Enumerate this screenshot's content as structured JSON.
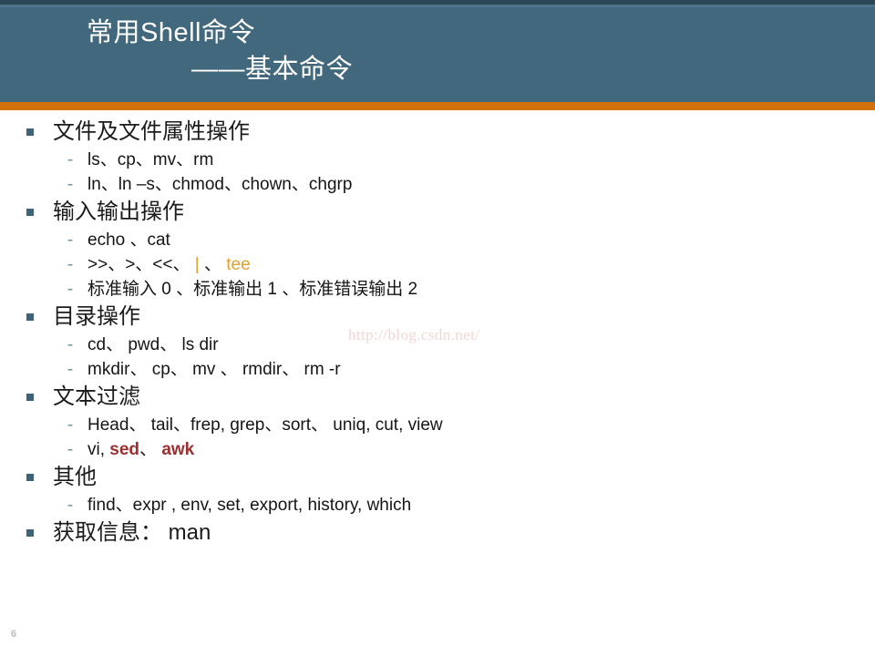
{
  "slide": {
    "title_line_1": "常用Shell命令",
    "title_line_2": "——基本命令",
    "number": "6",
    "watermark": "http://blog.csdn.net/",
    "colors": {
      "header_bg": "#42687d",
      "accent_bar": "#d2700c",
      "bullet": "#3f6376",
      "highlight_gold": "#e2a033",
      "highlight_red": "#9c3030"
    }
  },
  "sections": [
    {
      "heading": "文件及文件属性操作",
      "items": [
        {
          "text": "ls、cp、mv、rm"
        },
        {
          "text": "ln、ln –s、chmod、chown、chgrp"
        }
      ]
    },
    {
      "heading": "输入输出操作",
      "items": [
        {
          "text": "echo 、cat"
        },
        {
          "parts": [
            {
              "text": ">>、>、<<、",
              "style": "normal"
            },
            {
              "text": " | ",
              "style": "gold"
            },
            {
              "text": "、",
              "style": "normal"
            },
            {
              "text": " tee",
              "style": "gold"
            }
          ]
        },
        {
          "text": "标准输入 0 、标准输出 1 、标准错误输出 2"
        }
      ]
    },
    {
      "heading": "目录操作",
      "items": [
        {
          "text": "cd、 pwd、 ls dir"
        },
        {
          "text": "mkdir、 cp、 mv 、 rmdir、 rm -r"
        }
      ]
    },
    {
      "heading": "文本过滤",
      "items": [
        {
          "text": "Head、 tail、frep, grep、sort、 uniq, cut, view"
        },
        {
          "parts": [
            {
              "text": "vi, ",
              "style": "normal"
            },
            {
              "text": "sed",
              "style": "red"
            },
            {
              "text": "、",
              "style": "normal"
            },
            {
              "text": " awk",
              "style": "red"
            }
          ]
        }
      ]
    },
    {
      "heading": "其他",
      "items": [
        {
          "text": "find、expr , env, set, export, history, which"
        }
      ]
    },
    {
      "heading": "获取信息： man",
      "items": []
    }
  ]
}
